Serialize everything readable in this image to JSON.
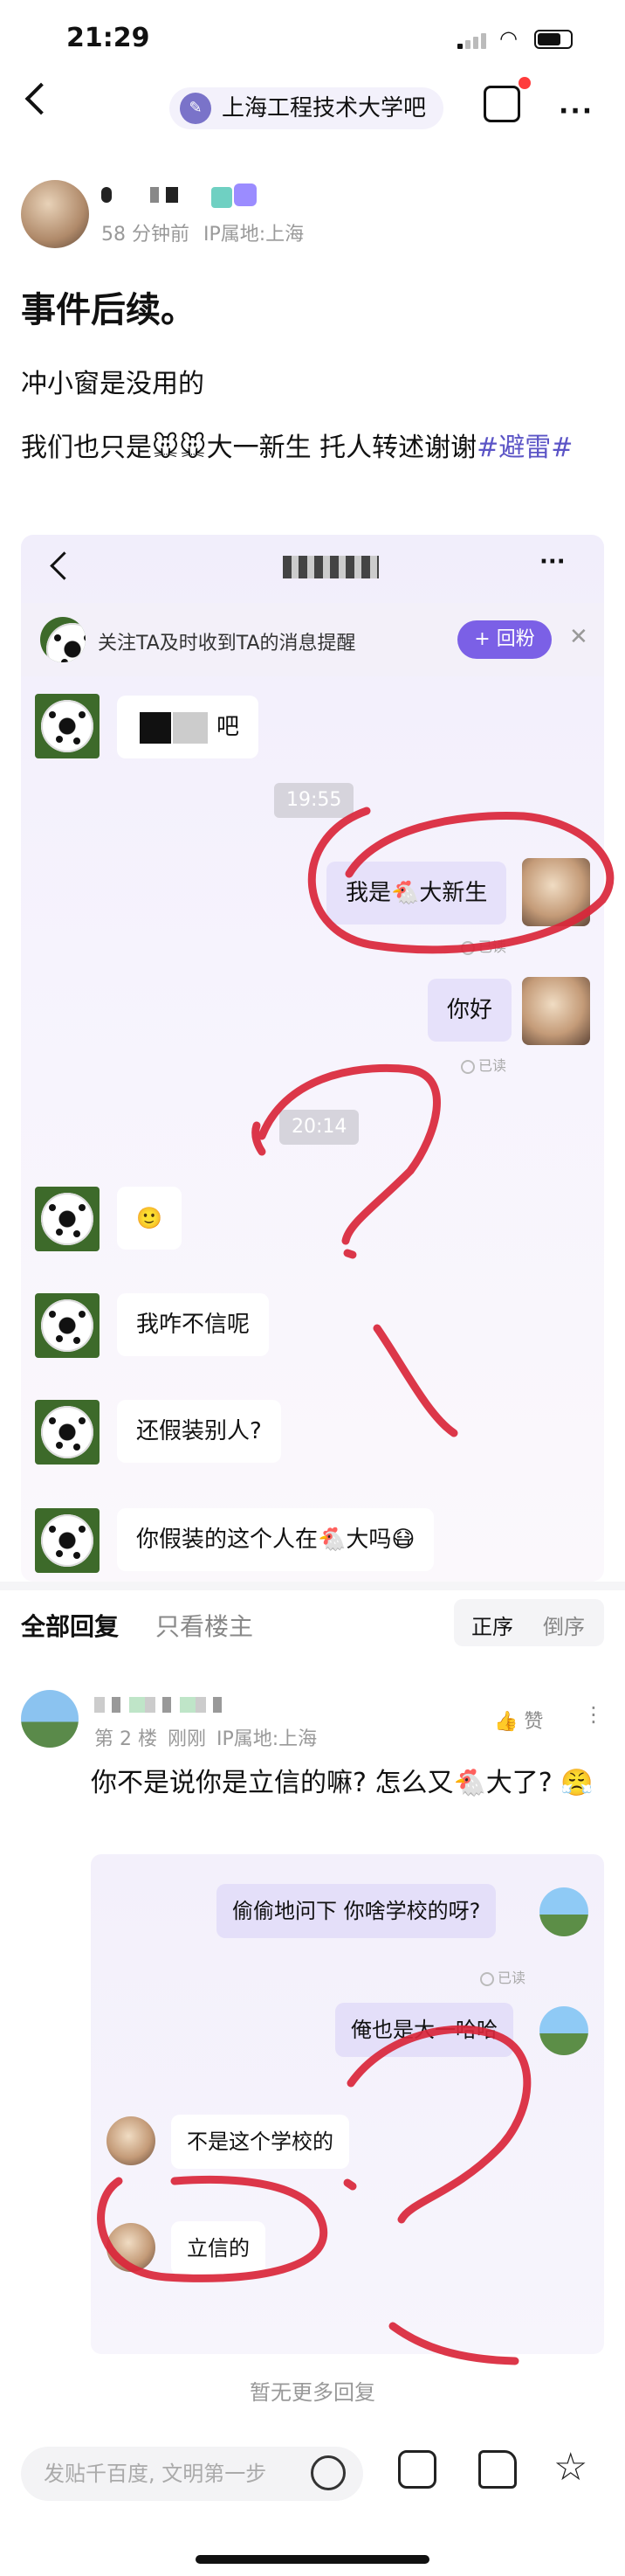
{
  "status_bar": {
    "time": "21:29"
  },
  "nav": {
    "title": "上海工程技术大学吧",
    "bar_icon": "bar-logo-icon"
  },
  "author": {
    "time_ago": "58 分钟前",
    "ip": "IP属地:上海"
  },
  "post": {
    "title": "事件后续。",
    "line1": "冲小窗是没用的",
    "line2_text": "我们也只是🐭🐭大一新生 托人转述谢谢",
    "tag": "#避雷#"
  },
  "chat1": {
    "notify_text": "关注TA及时收到TA的消息提醒",
    "notify_button": "+ 回粉",
    "notify_close": "✕",
    "msg_ba": "吧",
    "time1": "19:55",
    "msg_me1": "我是🐔大新生",
    "read": "已读",
    "msg_me2": "你好",
    "time2": "20:14",
    "msg_emoji": "🙂",
    "msg_3": "我咋不信呢",
    "msg_4": "还假装别人?",
    "msg_5": "你假装的这个人在🐔大吗😷"
  },
  "comments": {
    "tab_all": "全部回复",
    "tab_host": "只看楼主",
    "sort_asc": "正序",
    "sort_desc": "倒序"
  },
  "comment1": {
    "floor": "第 2 楼",
    "time": "刚刚",
    "ip": "IP属地:上海",
    "like": "赞",
    "text": "你不是说你是立信的嘛? 怎么又🐔大了? 😤"
  },
  "chat2": {
    "msg1": "偷偷地问下 你啥学校的呀?",
    "read": "已读",
    "msg2": "俺也是大一哈哈",
    "msg3": "不是这个学校的",
    "msg4": "立信的"
  },
  "no_more": "暂无更多回复",
  "bottom": {
    "input_placeholder": "发贴千百度, 文明第一步"
  },
  "colors": {
    "accent": "#7b60e6",
    "tag": "#5b54c6",
    "annotation": "#d9263a"
  }
}
